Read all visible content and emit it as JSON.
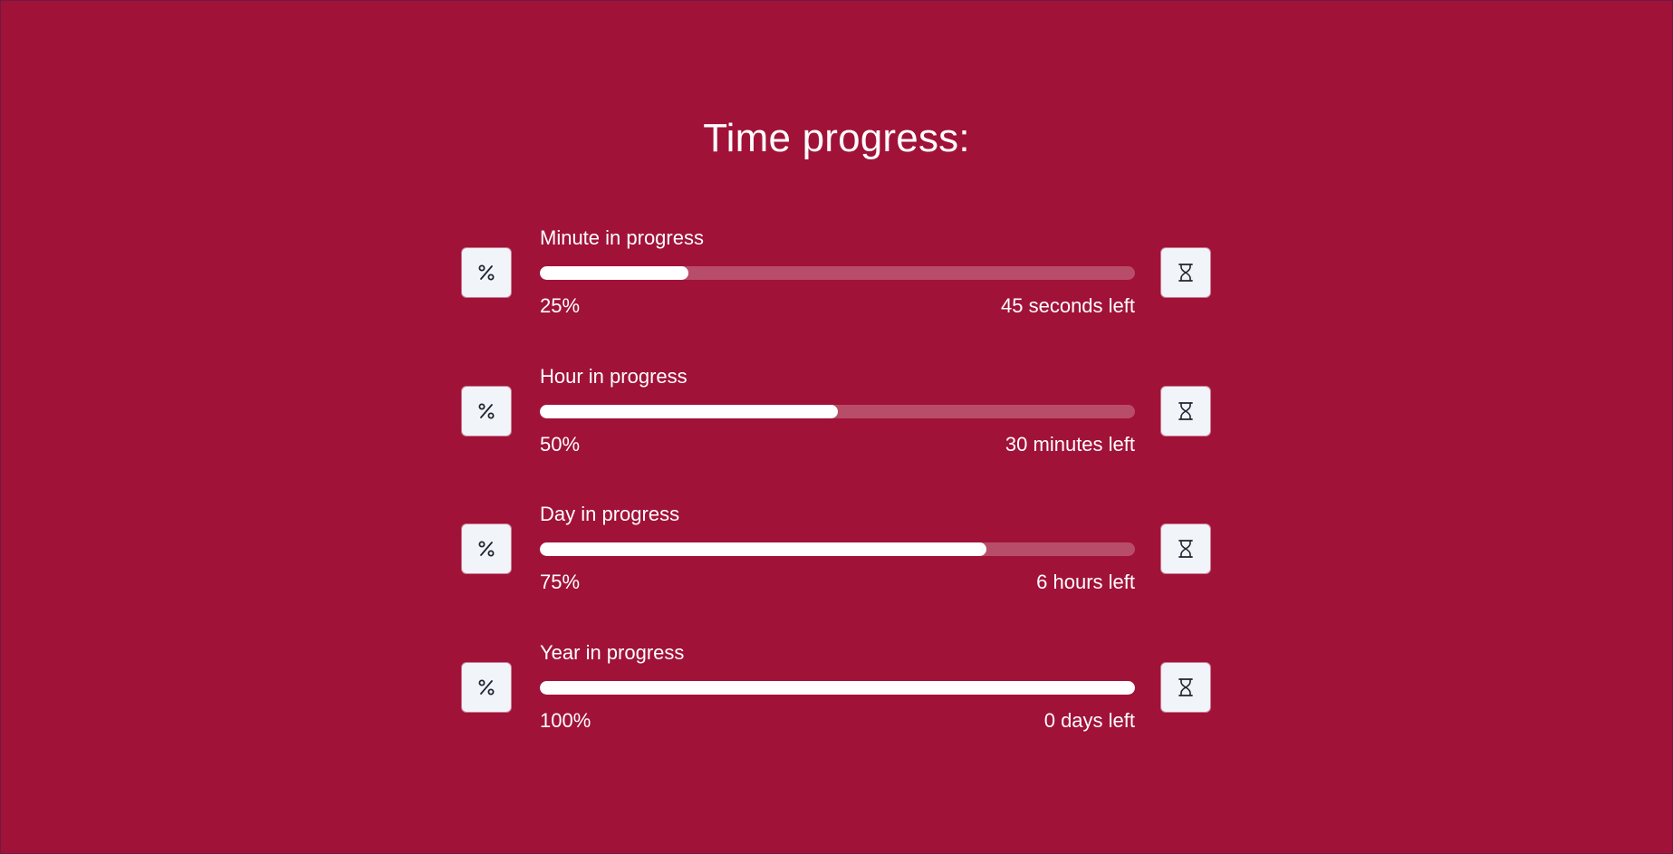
{
  "page": {
    "title": "Time progress:"
  },
  "colors": {
    "background": "#a11238",
    "bar_fill": "#ffffff",
    "bar_track": "rgba(255,255,255,0.25)",
    "button_bg": "#f1f4f8"
  },
  "icons": {
    "left": "percent-icon",
    "right": "hourglass-icon"
  },
  "rows": [
    {
      "label": "Minute in progress",
      "percent_text": "25%",
      "progress": 0.25,
      "remaining": "45 seconds left"
    },
    {
      "label": "Hour in progress",
      "percent_text": "50%",
      "progress": 0.5,
      "remaining": "30 minutes left"
    },
    {
      "label": "Day in progress",
      "percent_text": "75%",
      "progress": 0.75,
      "remaining": "6 hours left"
    },
    {
      "label": "Year in progress",
      "percent_text": "100%",
      "progress": 1.0,
      "remaining": "0 days left"
    }
  ]
}
